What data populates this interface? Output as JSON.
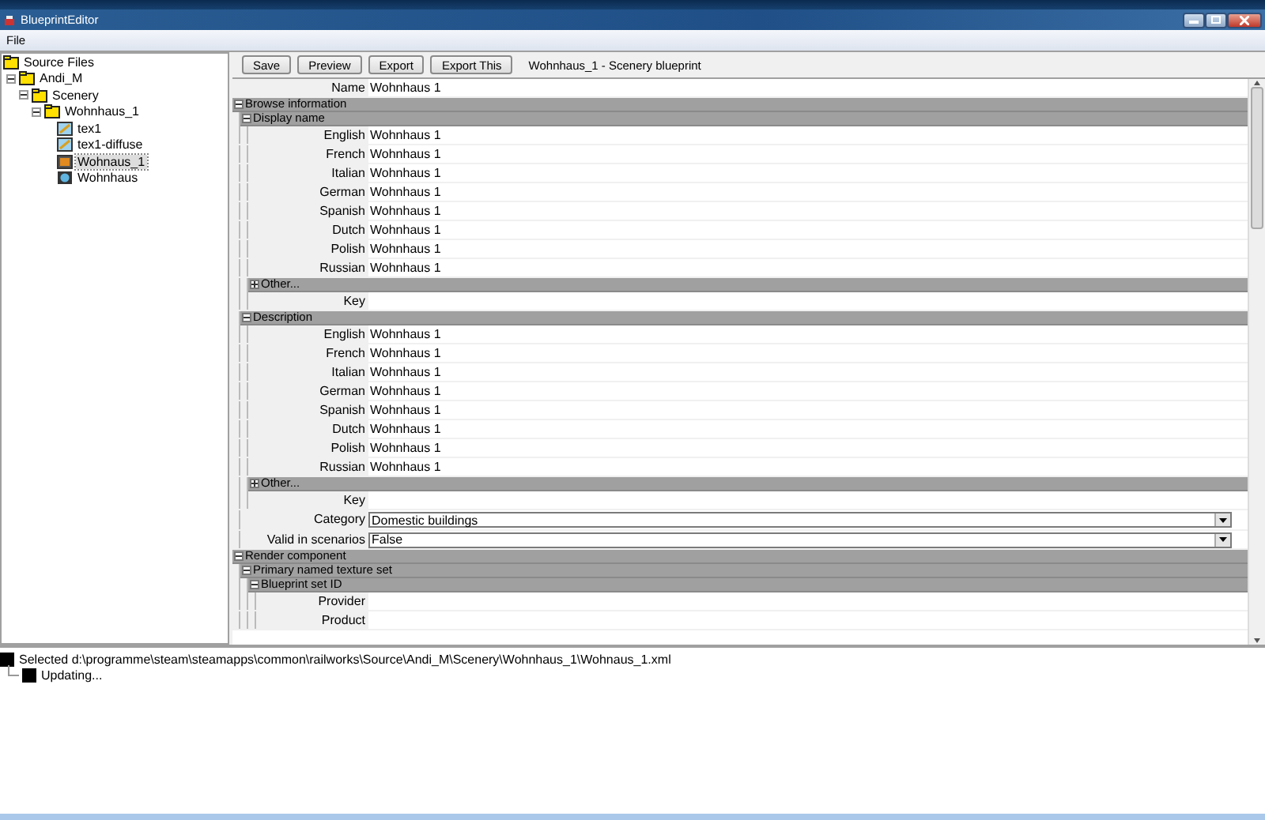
{
  "window": {
    "title": "BlueprintEditor"
  },
  "menu": [
    "File"
  ],
  "tree": {
    "root": {
      "label": "Source Files"
    },
    "items": [
      {
        "label": "Andi_M",
        "kind": "folder",
        "expanded": true,
        "selected": false,
        "children": [
          {
            "label": "Scenery",
            "kind": "folder",
            "expanded": true,
            "selected": false,
            "children": [
              {
                "label": "Wohnhaus_1",
                "kind": "folder",
                "expanded": true,
                "selected": false,
                "children": [
                  {
                    "label": "tex1",
                    "kind": "texture",
                    "selected": false
                  },
                  {
                    "label": "tex1-diffuse",
                    "kind": "texture",
                    "selected": false
                  },
                  {
                    "label": "Wohnaus_1",
                    "kind": "blueprint",
                    "selected": true
                  },
                  {
                    "label": "Wohnhaus",
                    "kind": "model",
                    "selected": false
                  }
                ]
              }
            ]
          }
        ]
      }
    ]
  },
  "toolbar": {
    "buttons": [
      "Save",
      "Preview",
      "Export",
      "Export This"
    ],
    "title": "Wohnhaus_1 - Scenery blueprint"
  },
  "grid": [
    {
      "kind": "field",
      "label": "Name",
      "value": "Wohnhaus 1"
    },
    {
      "kind": "section",
      "label": "Browse information",
      "expanded": true,
      "children": [
        {
          "kind": "section",
          "label": "Display name",
          "expanded": true,
          "children": [
            {
              "kind": "field",
              "label": "English",
              "value": "Wohnhaus 1"
            },
            {
              "kind": "field",
              "label": "French",
              "value": "Wohnhaus 1"
            },
            {
              "kind": "field",
              "label": "Italian",
              "value": "Wohnhaus 1"
            },
            {
              "kind": "field",
              "label": "German",
              "value": "Wohnhaus 1"
            },
            {
              "kind": "field",
              "label": "Spanish",
              "value": "Wohnhaus 1"
            },
            {
              "kind": "field",
              "label": "Dutch",
              "value": "Wohnhaus 1"
            },
            {
              "kind": "field",
              "label": "Polish",
              "value": "Wohnhaus 1"
            },
            {
              "kind": "field",
              "label": "Russian",
              "value": "Wohnhaus 1"
            },
            {
              "kind": "section",
              "label": "Other...",
              "expanded": false
            },
            {
              "kind": "field",
              "label": "Key"
            }
          ]
        },
        {
          "kind": "section",
          "label": "Description",
          "expanded": true,
          "children": [
            {
              "kind": "field",
              "label": "English",
              "value": "Wohnhaus 1"
            },
            {
              "kind": "field",
              "label": "French",
              "value": "Wohnhaus 1"
            },
            {
              "kind": "field",
              "label": "Italian",
              "value": "Wohnhaus 1"
            },
            {
              "kind": "field",
              "label": "German",
              "value": "Wohnhaus 1"
            },
            {
              "kind": "field",
              "label": "Spanish",
              "value": "Wohnhaus 1"
            },
            {
              "kind": "field",
              "label": "Dutch",
              "value": "Wohnhaus 1"
            },
            {
              "kind": "field",
              "label": "Polish",
              "value": "Wohnhaus 1"
            },
            {
              "kind": "field",
              "label": "Russian",
              "value": "Wohnhaus 1"
            },
            {
              "kind": "section",
              "label": "Other...",
              "expanded": false
            },
            {
              "kind": "field",
              "label": "Key"
            }
          ]
        },
        {
          "kind": "dropdown",
          "label": "Category",
          "value": "Domestic buildings"
        },
        {
          "kind": "dropdown",
          "label": "Valid in scenarios",
          "value": "False"
        }
      ]
    },
    {
      "kind": "section",
      "label": "Render component",
      "expanded": true,
      "children": [
        {
          "kind": "section",
          "label": "Primary named texture set",
          "expanded": true,
          "children": [
            {
              "kind": "section",
              "label": "Blueprint set ID",
              "expanded": true,
              "children": [
                {
                  "kind": "field",
                  "label": "Provider"
                },
                {
                  "kind": "field",
                  "label": "Product"
                }
              ]
            }
          ]
        }
      ]
    }
  ],
  "log": [
    {
      "text": "Selected d:\\programme\\steam\\steamapps\\common\\railworks\\Source\\Andi_M\\Scenery\\Wohnhaus_1\\Wohnaus_1.xml",
      "children": [
        {
          "text": "Updating..."
        }
      ]
    }
  ]
}
